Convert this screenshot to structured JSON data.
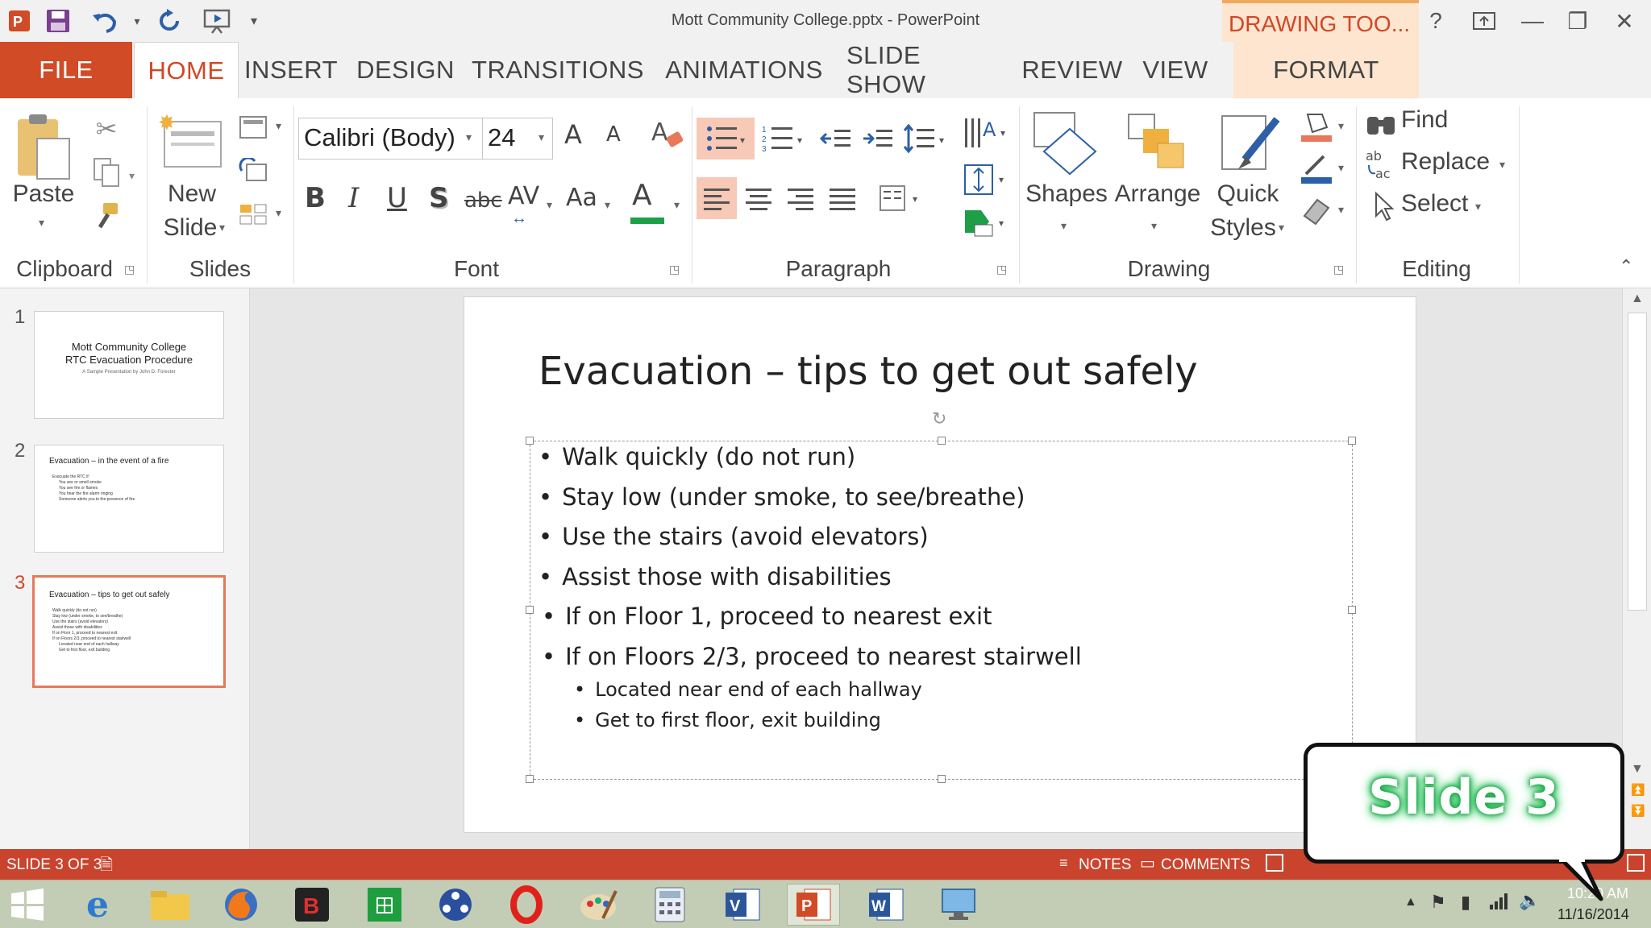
{
  "window": {
    "title": "Mott Community College.pptx - PowerPoint",
    "contextual_tab_group": "DRAWING TOO...",
    "help": "?",
    "minimize": "—",
    "restore": "❐",
    "close": "✕"
  },
  "tabs": {
    "file": "FILE",
    "home": "HOME",
    "insert": "INSERT",
    "design": "DESIGN",
    "transitions": "TRANSITIONS",
    "animations": "ANIMATIONS",
    "slideshow": "SLIDE SHOW",
    "review": "REVIEW",
    "view": "VIEW",
    "format": "FORMAT"
  },
  "ribbon": {
    "clipboard": {
      "label": "Clipboard",
      "paste": "Paste"
    },
    "slides": {
      "label": "Slides",
      "new_slide_1": "New",
      "new_slide_2": "Slide"
    },
    "font": {
      "label": "Font",
      "font_name": "Calibri (Body)",
      "font_size": "24",
      "bold": "B",
      "italic": "I",
      "underline": "U",
      "shadow": "S",
      "strike": "abc",
      "spacing": "AV",
      "case": "Aa",
      "color": "A",
      "grow": "A",
      "shrink": "A"
    },
    "paragraph": {
      "label": "Paragraph"
    },
    "drawing": {
      "label": "Drawing",
      "shapes": "Shapes",
      "arrange": "Arrange",
      "quick_1": "Quick",
      "quick_2": "Styles"
    },
    "editing": {
      "label": "Editing",
      "find": "Find",
      "replace": "Replace",
      "select": "Select"
    }
  },
  "thumbnails": [
    {
      "num": "1",
      "title": "Mott Community College",
      "subtitle": "RTC Evacuation Procedure",
      "caption": "A Sample Presentation by John D. Forester"
    },
    {
      "num": "2",
      "title": "Evacuation – in the event of a fire",
      "lines": [
        "Evacuate the RTC if:",
        "You see or smell smoke",
        "You see fire or flames",
        "You hear the fire alarm ringing",
        "Someone alerts you to the presence of fire"
      ]
    },
    {
      "num": "3",
      "title": "Evacuation – tips to get out safely",
      "lines": [
        "Walk quickly (do not run)",
        "Stay low (under smoke, to see/breathe)",
        "Use the stairs (avoid elevators)",
        "Assist those with disabilities",
        "If on Floor 1, proceed to nearest exit",
        "If on Floors 2/3, proceed to nearest stairwell",
        "Located near end of each hallway",
        "Get to first floor, exit building"
      ]
    }
  ],
  "slide": {
    "title": "Evacuation – tips to get out safely",
    "bullets": [
      "Walk quickly (do not run)",
      "Stay low (under smoke, to see/breathe)",
      "Use the stairs (avoid elevators)",
      "Assist those with disabilities",
      "If on Floor 1, proceed to nearest exit",
      "If on Floors 2/3, proceed to nearest stairwell"
    ],
    "sub_bullets": [
      "Located near end of each hallway",
      "Get to first floor, exit building"
    ]
  },
  "status": {
    "slide_indicator": "SLIDE 3 OF 3",
    "notes": "NOTES",
    "comments": "COMMENTS"
  },
  "taskbar": {
    "time": "10:20 AM",
    "date": "11/16/2014"
  },
  "callout": {
    "text": "Slide 3"
  },
  "colors": {
    "accent": "#d24726",
    "statusbar": "#c9432d",
    "callout_glow": "#1fa34a"
  }
}
